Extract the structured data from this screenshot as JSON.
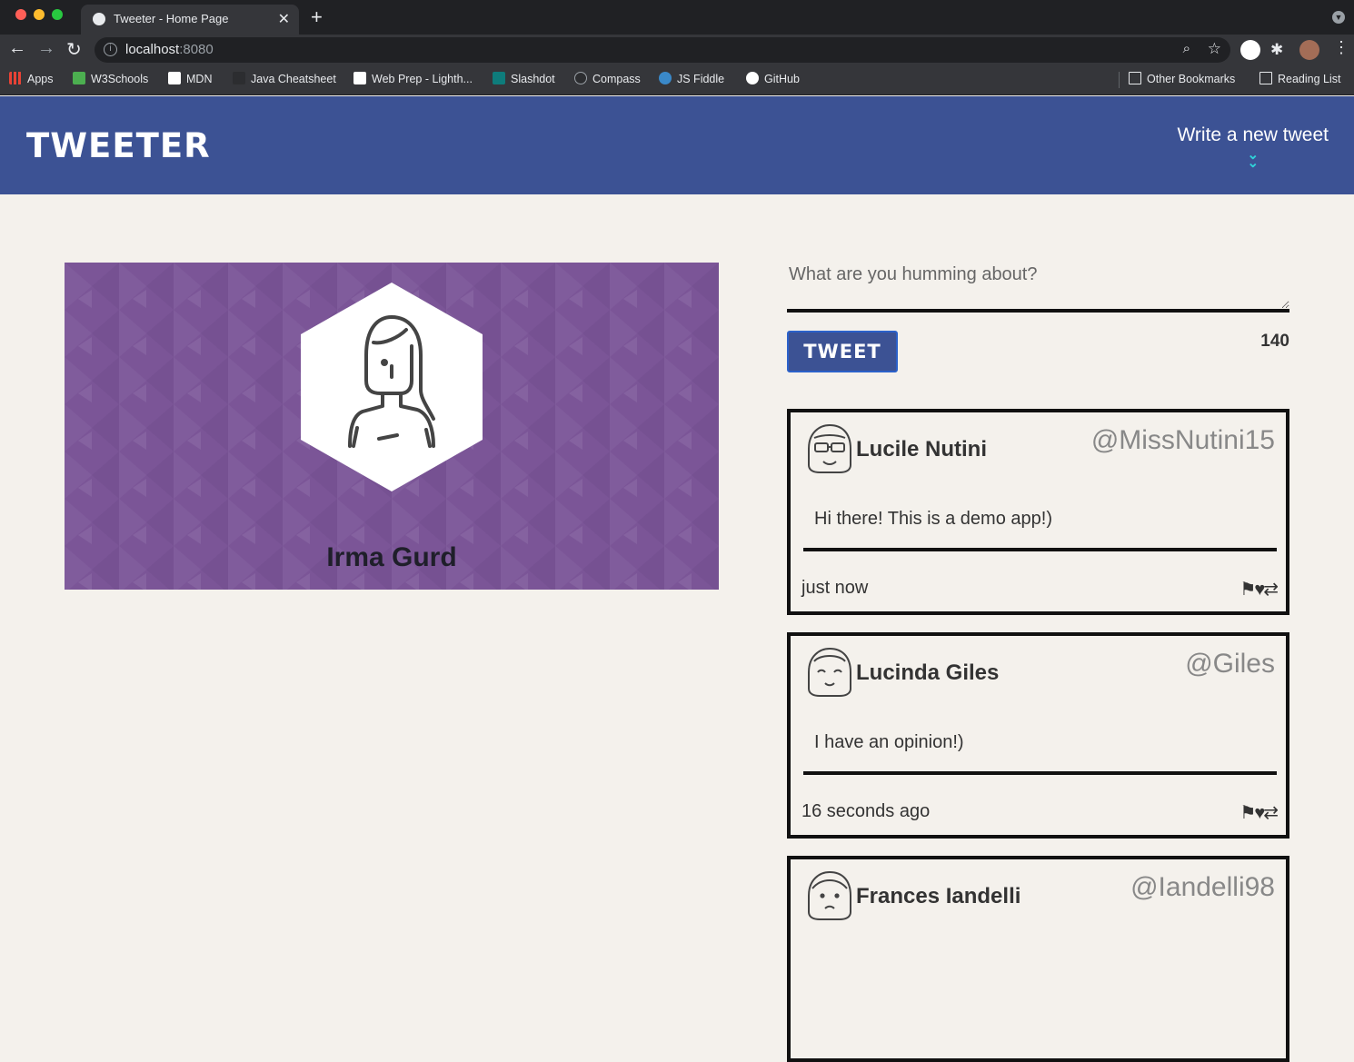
{
  "browser": {
    "tab_title": "Tweeter - Home Page",
    "tab_close": "✕",
    "new_tab": "+",
    "url_host": "localhost",
    "url_port": ":8080",
    "bookmarks": [
      {
        "label": "Apps",
        "icon": "apps-grid-icon",
        "color": "#e94235"
      },
      {
        "label": "W3Schools",
        "icon": "w3schools-icon",
        "color": "#4caf50"
      },
      {
        "label": "MDN",
        "icon": "mdn-icon",
        "color": "#ffffff"
      },
      {
        "label": "Java Cheatsheet",
        "icon": "java-icon",
        "color": "#35363a"
      },
      {
        "label": "Web Prep - Lighth...",
        "icon": "lighthouse-icon",
        "color": "#ffffff"
      },
      {
        "label": "Slashdot",
        "icon": "slashdot-icon",
        "color": "#0e7c7b"
      },
      {
        "label": "Compass",
        "icon": "compass-icon",
        "color": "#35363a"
      },
      {
        "label": "JS Fiddle",
        "icon": "jsfiddle-icon",
        "color": "#3a89c9"
      },
      {
        "label": "GitHub",
        "icon": "github-icon",
        "color": "#ffffff"
      }
    ],
    "other_bookmarks": "Other Bookmarks",
    "reading_list": "Reading List"
  },
  "nav": {
    "brand": "TWEETER",
    "write_label": "Write a new tweet",
    "write_icon": "double-chevron-down-icon",
    "accent": "#2fd3d9"
  },
  "profile": {
    "name": "Irma Gurd",
    "background": "#7b5597"
  },
  "composer": {
    "placeholder": "What are you humming about?",
    "button_label": "TWEET",
    "counter": "140"
  },
  "tweets": [
    {
      "name": "Lucile Nutini",
      "handle": "@MissNutini15",
      "content": "Hi there! This is a demo app!)",
      "time": "just now",
      "actions": "⚑♥⇄"
    },
    {
      "name": "Lucinda Giles",
      "handle": "@Giles",
      "content": "I have an opinion!)",
      "time": "16 seconds ago",
      "actions": "⚑♥⇄"
    },
    {
      "name": "Frances Iandelli",
      "handle": "@Iandelli98",
      "content": "",
      "time": "",
      "actions": "⚑♥⇄"
    }
  ]
}
